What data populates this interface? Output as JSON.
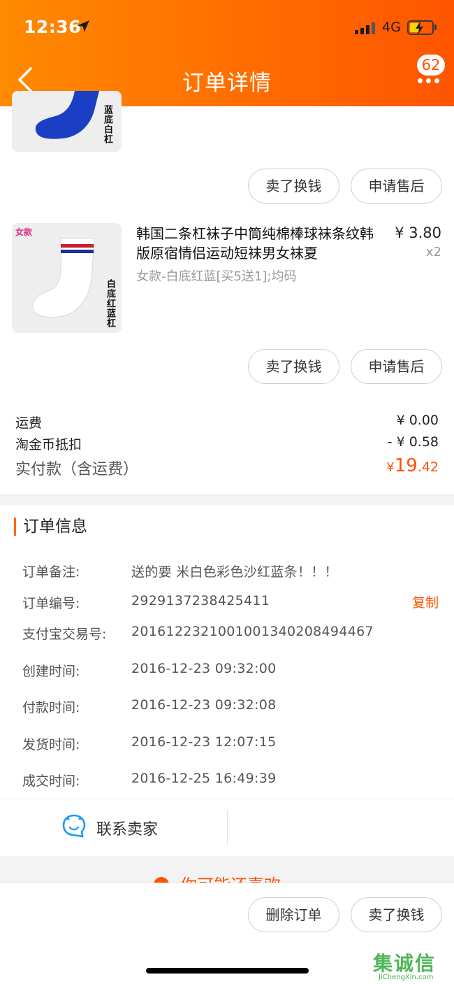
{
  "status_bar": {
    "time": "12:36",
    "network": "4G",
    "battery_level": 0.45
  },
  "header": {
    "title": "订单详情",
    "badge_count": "62",
    "back_icon": "chevron-left-icon",
    "more_icon": "more-dots-icon"
  },
  "items": [
    {
      "thumb_side_text": "蓝底白杠",
      "actions": [
        "卖了换钱",
        "申请售后"
      ]
    },
    {
      "thumb_tag": "女款",
      "thumb_side_text": "白底红蓝杠",
      "title": "韩国二条杠袜子中筒纯棉棒球袜条纹韩版原宿情侣运动短袜男女袜夏",
      "sku": "女款-白底红蓝[买5送1];均码",
      "price": "¥ 3.80",
      "quantity": "x2",
      "actions": [
        "卖了换钱",
        "申请售后"
      ]
    }
  ],
  "fees": {
    "shipping_label": "运费",
    "shipping_value": "¥ 0.00",
    "coin_label": "淘金币抵扣",
    "coin_value": "- ¥ 0.58",
    "total_label": "实付款（含运费）",
    "total_currency": "¥",
    "total_int": "19",
    "total_dec": ".42"
  },
  "order_info": {
    "section_title": "订单信息",
    "rows": [
      {
        "label": "订单备注:",
        "value": "送的要   米白色彩色沙红蓝条！！！"
      },
      {
        "label": "订单编号:",
        "value": "2929137238425411"
      },
      {
        "label": "支付宝交易号:",
        "value": "2016122321001001340208494467"
      },
      {
        "label": "创建时间:",
        "value": "2016-12-23 09:32:00"
      },
      {
        "label": "付款时间:",
        "value": "2016-12-23 09:32:08"
      },
      {
        "label": "发货时间:",
        "value": "2016-12-23 12:07:15"
      },
      {
        "label": "成交时间:",
        "value": "2016-12-25 16:49:39"
      }
    ],
    "copy_label": "复制"
  },
  "contact": {
    "label": "联系卖家",
    "icon": "chat-bubble-icon"
  },
  "recommend_peek": "你可能还喜欢",
  "bottom_actions": [
    "删除订单",
    "卖了换钱"
  ],
  "watermark": {
    "main": "集诚信",
    "sub": "JiChengXin.com"
  },
  "colors": {
    "accent": "#ff5000",
    "header_start": "#ff8a00",
    "header_end": "#ff5500"
  }
}
